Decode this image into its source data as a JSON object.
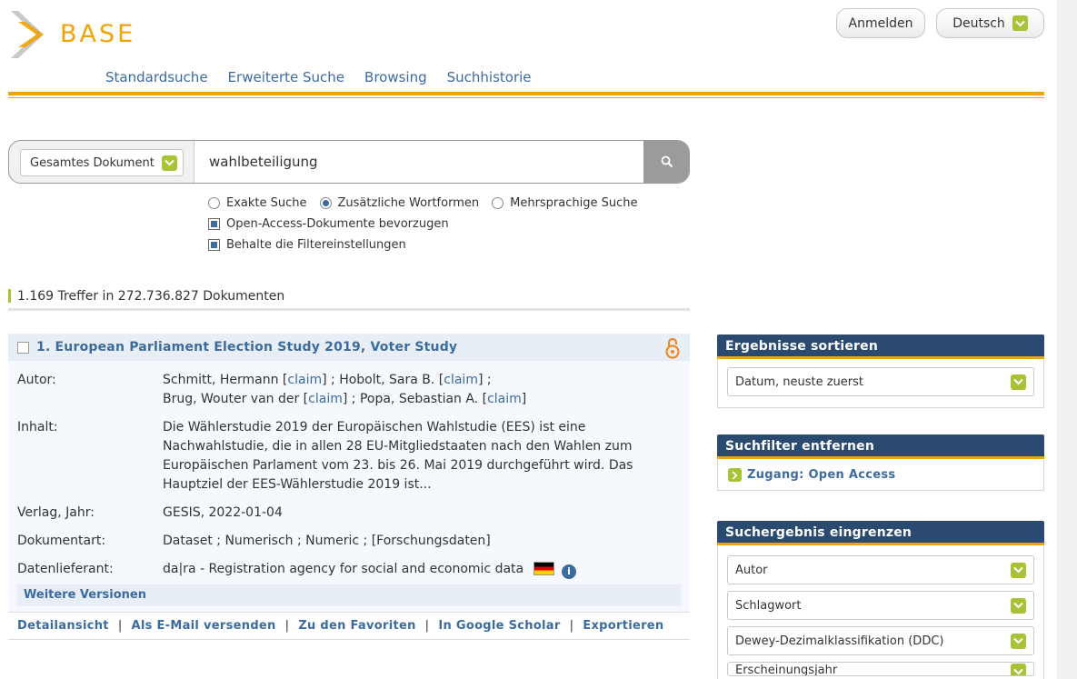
{
  "header": {
    "logo_text": "BASE",
    "login_label": "Anmelden",
    "language_label": "Deutsch"
  },
  "nav": {
    "items": [
      "Standardsuche",
      "Erweiterte Suche",
      "Browsing",
      "Suchhistorie"
    ]
  },
  "search": {
    "scope_label": "Gesamtes Dokument",
    "query": "wahlbeteiligung",
    "mode_options": [
      "Exakte Suche",
      "Zusätzliche Wortformen",
      "Mehrsprachige Suche"
    ],
    "selected_mode": "Zusätzliche Wortformen",
    "checkbox_oa": "Open-Access-Dokumente bevorzugen",
    "checkbox_keep": "Behalte die Filtereinstellungen"
  },
  "results": {
    "hits_text": "1.169 Treffer in 272.736.827 Dokumenten",
    "items": [
      {
        "title": "1. European Parliament Election Study 2019, Voter Study",
        "labels": {
          "author": "Autor:",
          "content": "Inhalt:",
          "publisher": "Verlag, Jahr:",
          "doctype": "Dokumentart:",
          "provider": "Datenlieferant:"
        },
        "authors": [
          {
            "name": "Schmitt, Hermann",
            "sep": " ;"
          },
          {
            "name": "Hobolt, Sara B.",
            "sep": " ;"
          },
          {
            "name": "Brug, Wouter van der",
            "sep": " ;"
          },
          {
            "name": "Popa, Sebastian A.",
            "sep": ""
          }
        ],
        "claim_label": "claim",
        "content": "Die Wählerstudie 2019 der Europäischen Wahlstudie (EES) ist eine Nachwahlstudie, die in allen 28 EU-Mitgliedstaaten nach den Wahlen zum Europäischen Parlament vom 23. bis 26. Mai 2019 durchgeführt wird. Das Hauptziel der EES-Wählerstudie 2019 ist...",
        "publisher": "GESIS, 2022-01-04",
        "doctype": "Dataset ; Numerisch ; Numeric ; [Forschungsdaten]",
        "provider": "da|ra - Registration agency for social and economic data",
        "versions_label": "Weitere Versionen",
        "links": [
          "Detailansicht",
          "Als E-Mail versenden",
          "Zu den Favoriten",
          "In Google Scholar",
          "Exportieren"
        ]
      }
    ]
  },
  "sidebar": {
    "sort_title": "Ergebnisse sortieren",
    "sort_value": "Datum, neuste zuerst",
    "remove_title": "Suchfilter entfernen",
    "active_filter": "Zugang: Open Access",
    "refine_title": "Suchergebnis eingrenzen",
    "refine_items": [
      "Autor",
      "Schlagwort",
      "Dewey-Dezimalklassifikation (DDC)",
      "Erscheinungsjahr"
    ]
  },
  "colors": {
    "accent_orange": "#f0a30a",
    "link_blue": "#3c6b9e",
    "panel_navy": "#2b4a6f",
    "chevron_green": "#a6c436"
  }
}
